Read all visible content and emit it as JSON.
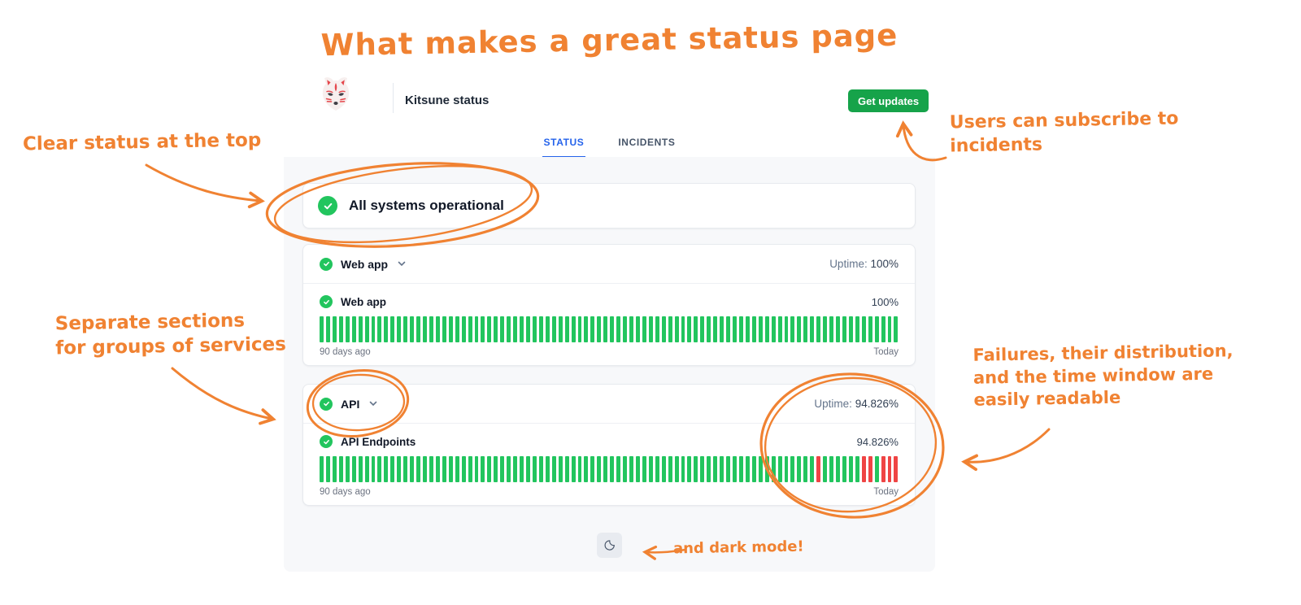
{
  "annotations": {
    "color": "#F08232",
    "title": "What makes a great status page",
    "clear_status": "Clear status at the top",
    "separate_sections": [
      "Separate sections",
      "for groups of services"
    ],
    "subscribe": [
      "Users can subscribe to",
      "incidents"
    ],
    "failures": [
      "Failures, their distribution,",
      "and the time window are",
      "easily readable"
    ],
    "dark_mode_note": "and dark mode!"
  },
  "header": {
    "brand": "Kitsune status",
    "get_updates_label": "Get updates",
    "logo_icon": "kitsune-fox-mask"
  },
  "tabs": [
    {
      "label": "STATUS",
      "active": true
    },
    {
      "label": "INCIDENTS",
      "active": false
    }
  ],
  "overall_status": {
    "icon": "check-circle",
    "label": "All systems operational"
  },
  "groups": [
    {
      "icon": "check-circle",
      "name": "Web app",
      "uptime_label": "Uptime:",
      "uptime_value": "100%",
      "service": {
        "icon": "check-circle",
        "name": "Web app",
        "percent": "100%",
        "days": 90,
        "down_days": [],
        "range_start": "90 days ago",
        "range_end": "Today"
      }
    },
    {
      "icon": "check-circle",
      "name": "API",
      "uptime_label": "Uptime:",
      "uptime_value": "94.826%",
      "service": {
        "icon": "check-circle",
        "name": "API Endpoints",
        "percent": "94.826%",
        "days": 90,
        "down_days": [
          77,
          84,
          85,
          87,
          88,
          89
        ],
        "range_start": "90 days ago",
        "range_end": "Today"
      }
    }
  ],
  "footer": {
    "dark_mode_icon": "moon"
  },
  "colors": {
    "annotation_orange": "#F08232",
    "button_green": "#16A34A",
    "status_green": "#22C55E",
    "bar_green": "#22C55E",
    "bar_red": "#EF4444",
    "tab_blue": "#2563EB"
  }
}
